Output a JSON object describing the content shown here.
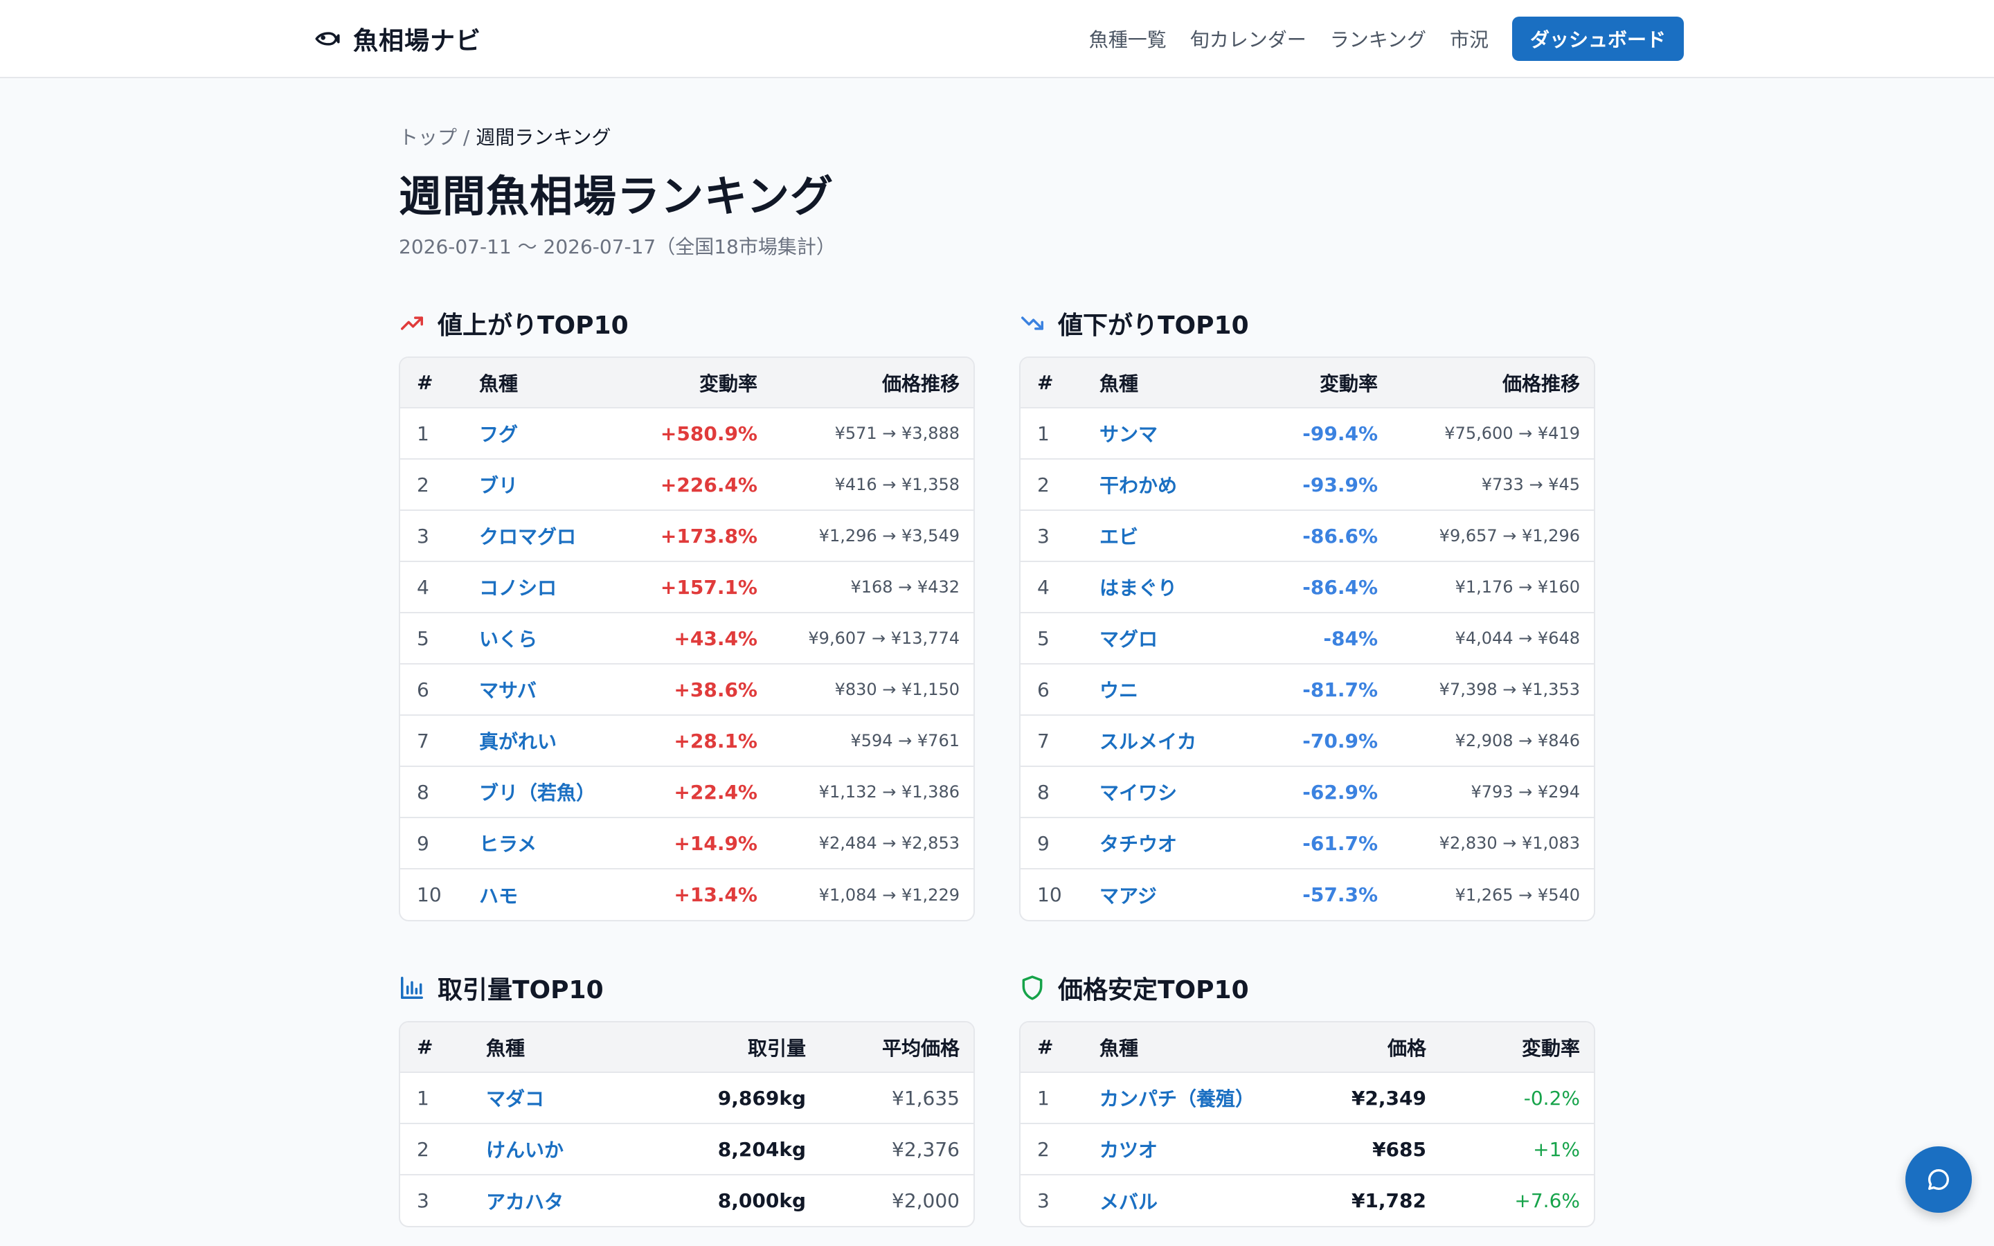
{
  "header": {
    "brand": "魚相場ナビ",
    "nav": [
      "魚種一覧",
      "旬カレンダー",
      "ランキング",
      "市況"
    ],
    "cta": "ダッシュボード"
  },
  "breadcrumb": {
    "home": "トップ",
    "separator": " / ",
    "current": "週間ランキング"
  },
  "page": {
    "title": "週間魚相場ランキング",
    "subtitle": "2026-07-11 〜 2026-07-17（全国18市場集計）"
  },
  "colors": {
    "accent": "#1a6fc2",
    "up": "#e03b3b",
    "down": "#3b82e0",
    "stable": "#16a34a"
  },
  "rising": {
    "title": "値上がりTOP10",
    "icon": "trending-up-icon",
    "headers": [
      "#",
      "魚種",
      "変動率",
      "価格推移"
    ],
    "rows": [
      {
        "rank": "1",
        "name": "フグ",
        "change": "+580.9%",
        "trend": "¥571 → ¥3,888"
      },
      {
        "rank": "2",
        "name": "ブリ",
        "change": "+226.4%",
        "trend": "¥416 → ¥1,358"
      },
      {
        "rank": "3",
        "name": "クロマグロ",
        "change": "+173.8%",
        "trend": "¥1,296 → ¥3,549"
      },
      {
        "rank": "4",
        "name": "コノシロ",
        "change": "+157.1%",
        "trend": "¥168 → ¥432"
      },
      {
        "rank": "5",
        "name": "いくら",
        "change": "+43.4%",
        "trend": "¥9,607 → ¥13,774"
      },
      {
        "rank": "6",
        "name": "マサバ",
        "change": "+38.6%",
        "trend": "¥830 → ¥1,150"
      },
      {
        "rank": "7",
        "name": "真がれい",
        "change": "+28.1%",
        "trend": "¥594 → ¥761"
      },
      {
        "rank": "8",
        "name": "ブリ（若魚）",
        "change": "+22.4%",
        "trend": "¥1,132 → ¥1,386"
      },
      {
        "rank": "9",
        "name": "ヒラメ",
        "change": "+14.9%",
        "trend": "¥2,484 → ¥2,853"
      },
      {
        "rank": "10",
        "name": "ハモ",
        "change": "+13.4%",
        "trend": "¥1,084 → ¥1,229"
      }
    ]
  },
  "falling": {
    "title": "値下がりTOP10",
    "icon": "trending-down-icon",
    "headers": [
      "#",
      "魚種",
      "変動率",
      "価格推移"
    ],
    "rows": [
      {
        "rank": "1",
        "name": "サンマ",
        "change": "-99.4%",
        "trend": "¥75,600 → ¥419"
      },
      {
        "rank": "2",
        "name": "干わかめ",
        "change": "-93.9%",
        "trend": "¥733 → ¥45"
      },
      {
        "rank": "3",
        "name": "エビ",
        "change": "-86.6%",
        "trend": "¥9,657 → ¥1,296"
      },
      {
        "rank": "4",
        "name": "はまぐり",
        "change": "-86.4%",
        "trend": "¥1,176 → ¥160"
      },
      {
        "rank": "5",
        "name": "マグロ",
        "change": "-84%",
        "trend": "¥4,044 → ¥648"
      },
      {
        "rank": "6",
        "name": "ウニ",
        "change": "-81.7%",
        "trend": "¥7,398 → ¥1,353"
      },
      {
        "rank": "7",
        "name": "スルメイカ",
        "change": "-70.9%",
        "trend": "¥2,908 → ¥846"
      },
      {
        "rank": "8",
        "name": "マイワシ",
        "change": "-62.9%",
        "trend": "¥793 → ¥294"
      },
      {
        "rank": "9",
        "name": "タチウオ",
        "change": "-61.7%",
        "trend": "¥2,830 → ¥1,083"
      },
      {
        "rank": "10",
        "name": "マアジ",
        "change": "-57.3%",
        "trend": "¥1,265 → ¥540"
      }
    ]
  },
  "volume": {
    "title": "取引量TOP10",
    "icon": "bar-chart-icon",
    "headers": [
      "#",
      "魚種",
      "取引量",
      "平均価格"
    ],
    "rows": [
      {
        "rank": "1",
        "name": "マダコ",
        "volume": "9,869kg",
        "avg": "¥1,635"
      },
      {
        "rank": "2",
        "name": "けんいか",
        "volume": "8,204kg",
        "avg": "¥2,376"
      },
      {
        "rank": "3",
        "name": "アカハタ",
        "volume": "8,000kg",
        "avg": "¥2,000"
      }
    ]
  },
  "stable": {
    "title": "価格安定TOP10",
    "icon": "shield-icon",
    "headers": [
      "#",
      "魚種",
      "価格",
      "変動率"
    ],
    "rows": [
      {
        "rank": "1",
        "name": "カンパチ（養殖）",
        "price": "¥2,349",
        "change": "-0.2%"
      },
      {
        "rank": "2",
        "name": "カツオ",
        "price": "¥685",
        "change": "+1%"
      },
      {
        "rank": "3",
        "name": "メバル",
        "price": "¥1,782",
        "change": "+7.6%"
      }
    ]
  },
  "chat": {
    "icon": "chat-bubble-icon"
  }
}
